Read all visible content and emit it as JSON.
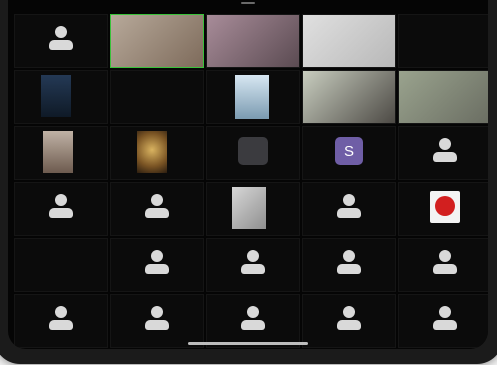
{
  "tiles": [
    {
      "name": "",
      "kind": "generic"
    },
    {
      "name": "",
      "kind": "photo-room",
      "active": true
    },
    {
      "name": "",
      "kind": "photo-room2"
    },
    {
      "name": "",
      "kind": "photo-room3"
    },
    {
      "name": "",
      "kind": "empty"
    },
    {
      "name": "",
      "kind": "photo-man-night"
    },
    {
      "name": "",
      "kind": "empty"
    },
    {
      "name": "",
      "kind": "photo-ceiling"
    },
    {
      "name": "",
      "kind": "photo-room4"
    },
    {
      "name": "",
      "kind": "photo-room5"
    },
    {
      "name": "",
      "kind": "photo-man-glasses"
    },
    {
      "name": "",
      "kind": "photo-logo"
    },
    {
      "name": "",
      "kind": "dark-square"
    },
    {
      "name": "",
      "kind": "letter",
      "letter": "S"
    },
    {
      "name": "",
      "kind": "generic"
    },
    {
      "name": "",
      "kind": "generic"
    },
    {
      "name": "",
      "kind": "generic"
    },
    {
      "name": "",
      "kind": "photo-group"
    },
    {
      "name": "",
      "kind": "generic"
    },
    {
      "name": "",
      "kind": "emblem"
    },
    {
      "name": "",
      "kind": "empty"
    },
    {
      "name": "",
      "kind": "generic"
    },
    {
      "name": "",
      "kind": "generic"
    },
    {
      "name": "",
      "kind": "generic"
    },
    {
      "name": "",
      "kind": "generic"
    },
    {
      "name": "",
      "kind": "generic"
    },
    {
      "name": "",
      "kind": "generic"
    },
    {
      "name": "",
      "kind": "generic"
    },
    {
      "name": "",
      "kind": "generic"
    },
    {
      "name": "",
      "kind": "generic"
    }
  ]
}
